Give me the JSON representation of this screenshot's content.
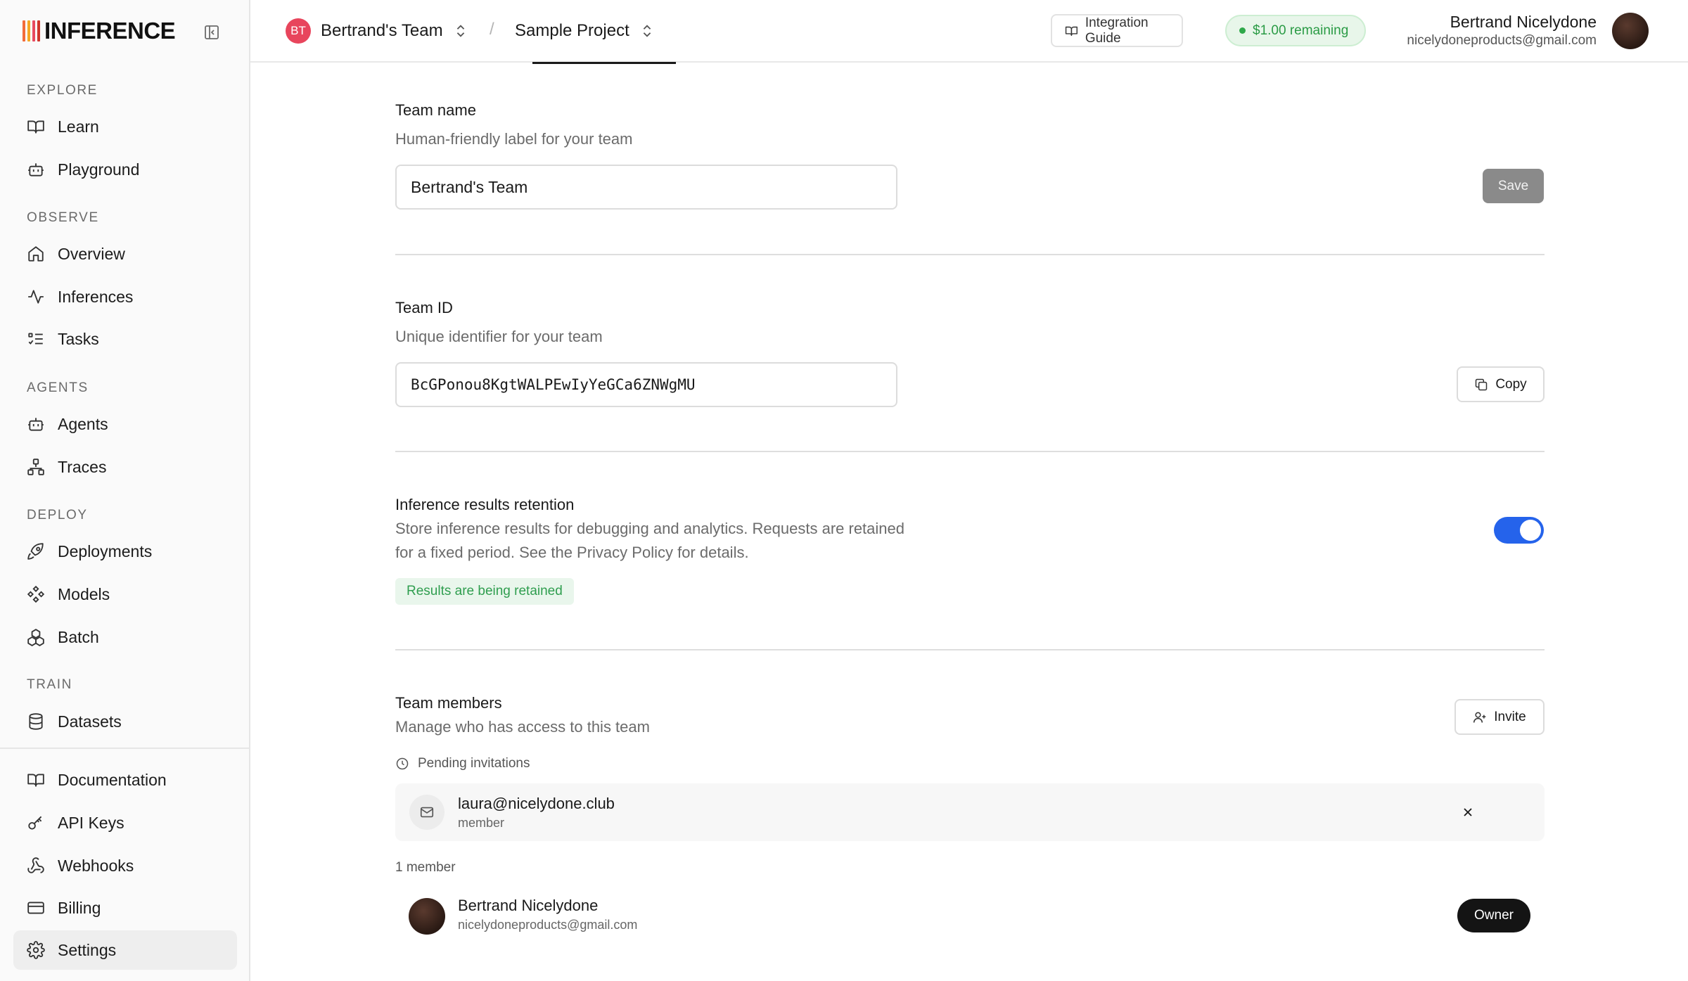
{
  "brand": {
    "name": "INFERENCE",
    "bar_colors": [
      "#f26b3a",
      "#f5a623",
      "#e84a5f",
      "#d0352b"
    ]
  },
  "sidebar": {
    "sections": [
      {
        "title": "EXPLORE",
        "items": [
          {
            "label": "Learn",
            "icon": "book-icon"
          },
          {
            "label": "Playground",
            "icon": "bot-icon"
          }
        ]
      },
      {
        "title": "OBSERVE",
        "items": [
          {
            "label": "Overview",
            "icon": "home-icon"
          },
          {
            "label": "Inferences",
            "icon": "activity-icon"
          },
          {
            "label": "Tasks",
            "icon": "tasks-icon"
          }
        ]
      },
      {
        "title": "AGENTS",
        "items": [
          {
            "label": "Agents",
            "icon": "bot-icon"
          },
          {
            "label": "Traces",
            "icon": "network-icon"
          }
        ]
      },
      {
        "title": "DEPLOY",
        "items": [
          {
            "label": "Deployments",
            "icon": "rocket-icon"
          },
          {
            "label": "Models",
            "icon": "models-icon"
          },
          {
            "label": "Batch",
            "icon": "batch-icon"
          }
        ]
      },
      {
        "title": "TRAIN",
        "items": [
          {
            "label": "Datasets",
            "icon": "database-icon"
          }
        ]
      }
    ],
    "footer_items": [
      {
        "label": "Documentation",
        "icon": "book-icon"
      },
      {
        "label": "API Keys",
        "icon": "key-icon"
      },
      {
        "label": "Webhooks",
        "icon": "webhook-icon"
      },
      {
        "label": "Billing",
        "icon": "credit-card-icon"
      },
      {
        "label": "Settings",
        "icon": "gear-icon",
        "active": true
      }
    ]
  },
  "topbar": {
    "team_initials": "BT",
    "team_name": "Bertrand's Team",
    "separator": "/",
    "project_name": "Sample Project",
    "integration_guide": "Integration Guide",
    "credits": "$1.00 remaining",
    "user_name": "Bertrand Nicelydone",
    "user_email": "nicelydoneproducts@gmail.com"
  },
  "settings": {
    "team_name": {
      "title": "Team name",
      "description": "Human-friendly label for your team",
      "value": "Bertrand's Team",
      "save_label": "Save"
    },
    "team_id": {
      "title": "Team ID",
      "description": "Unique identifier for your team",
      "value": "BcGPonou8KgtWALPEwIyYeGCa6ZNWgMU",
      "copy_label": "Copy"
    },
    "retention": {
      "title": "Inference results retention",
      "description_line1": "Store inference results for debugging and analytics. Requests are retained",
      "description_line2": "for a fixed period. See the Privacy Policy for details.",
      "enabled": true,
      "status": "Results are being retained"
    },
    "members": {
      "title": "Team members",
      "description": "Manage who has access to this team",
      "invite_label": "Invite",
      "pending_label": "Pending invitations",
      "pending": [
        {
          "email": "laura@nicelydone.club",
          "role": "member"
        }
      ],
      "count_label": "1 member",
      "list": [
        {
          "name": "Bertrand Nicelydone",
          "email": "nicelydoneproducts@gmail.com",
          "role": "Owner"
        }
      ]
    }
  }
}
